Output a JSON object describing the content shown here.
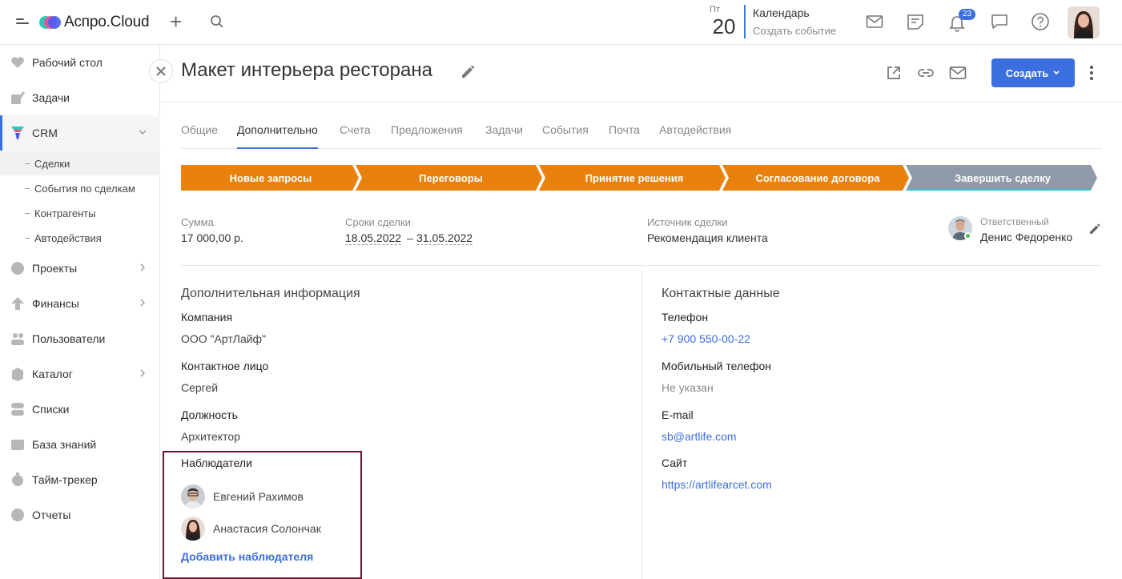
{
  "app": {
    "name": "Аспро.Cloud"
  },
  "topbar": {
    "date_dow": "Пт",
    "date_num": "20",
    "calendar_title": "Календарь",
    "calendar_sub": "Создать событие",
    "notifications_count": "23"
  },
  "sidebar": {
    "items": [
      {
        "label": "Рабочий стол",
        "icon": "heart-icon"
      },
      {
        "label": "Задачи",
        "icon": "check-icon"
      },
      {
        "label": "CRM",
        "icon": "funnel-icon"
      },
      {
        "label": "Проекты",
        "icon": "pie-icon"
      },
      {
        "label": "Финансы",
        "icon": "arrow-up-icon"
      },
      {
        "label": "Пользователи",
        "icon": "users-icon"
      },
      {
        "label": "Каталог",
        "icon": "catalog-icon"
      },
      {
        "label": "Списки",
        "icon": "toggles-icon"
      },
      {
        "label": "База знаний",
        "icon": "book-icon"
      },
      {
        "label": "Тайм-трекер",
        "icon": "timer-icon"
      },
      {
        "label": "Отчеты",
        "icon": "report-icon"
      }
    ],
    "crm_sub": [
      {
        "label": "Сделки"
      },
      {
        "label": "События по сделкам"
      },
      {
        "label": "Контрагенты"
      },
      {
        "label": "Автодействия"
      }
    ]
  },
  "deal": {
    "title": "Макет интерьера ресторана",
    "create_label": "Создать"
  },
  "tabs": [
    "Общие",
    "Дополнительно",
    "Счета",
    "Предложения",
    "Задачи",
    "События",
    "Почта",
    "Автодействия"
  ],
  "stages": [
    {
      "label": "Новые запросы",
      "state": "done"
    },
    {
      "label": "Переговоры",
      "state": "done"
    },
    {
      "label": "Принятие решения",
      "state": "done"
    },
    {
      "label": "Согласование договора",
      "state": "done"
    },
    {
      "label": "Завершить сделку",
      "state": "pending"
    }
  ],
  "colors": {
    "stage_done": "#e8810d",
    "stage_pending": "#909aa8",
    "accent": "#3b6fe0"
  },
  "summary": {
    "amount_label": "Сумма",
    "amount_value": "17 000,00 р.",
    "period_label": "Сроки сделки",
    "period_start": "18.05.2022",
    "period_sep": "–",
    "period_end": "31.05.2022",
    "source_label": "Источник сделки",
    "source_value": "Рекомендация клиента",
    "responsible_label": "Ответственный",
    "responsible_value": "Денис Федоренко"
  },
  "additional": {
    "title": "Дополнительная информация",
    "company_label": "Компания",
    "company_value": "ООО \"АртЛайф\"",
    "contact_label": "Контактное лицо",
    "contact_value": "Сергей",
    "position_label": "Должность",
    "position_value": "Архитектор",
    "watchers_label": "Наблюдатели",
    "watchers": [
      {
        "name": "Евгений Рахимов"
      },
      {
        "name": "Анастасия Солончак"
      }
    ],
    "add_watcher": "Добавить наблюдателя"
  },
  "contacts": {
    "title": "Контактные данные",
    "phone_label": "Телефон",
    "phone_value": "+7 900 550-00-22",
    "mobile_label": "Мобильный телефон",
    "mobile_value": "Не указан",
    "email_label": "E-mail",
    "email_value": "sb@artlife.com",
    "site_label": "Сайт",
    "site_value": "https://artlifearcet.com"
  }
}
